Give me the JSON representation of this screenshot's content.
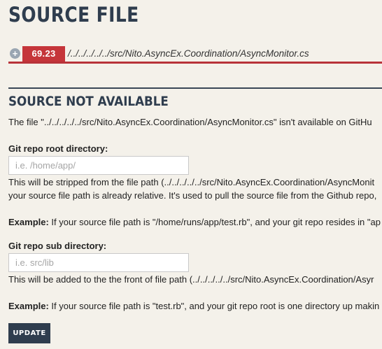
{
  "page": {
    "title": "SOURCE FILE"
  },
  "file": {
    "coverage": "69.23",
    "path": "/../../../../../src/Nito.AsyncEx.Coordination/AsyncMonitor.cs",
    "expand_icon": "plus-circle-icon"
  },
  "section": {
    "title": "SOURCE NOT AVAILABLE",
    "message": "The file \"../../../../../src/Nito.AsyncEx.Coordination/AsyncMonitor.cs\" isn't available on GitHu"
  },
  "repo_root": {
    "label": "Git repo root directory:",
    "placeholder": "i.e. /home/app/",
    "value": "",
    "help_line1": "This will be stripped from the file path (../../../../../src/Nito.AsyncEx.Coordination/AsyncMonit",
    "help_line2": "your source file path is already relative. It's used to pull the source file from the Github repo,",
    "example_label": "Example:",
    "example_text": " If your source file path is \"/home/runs/app/test.rb\", and your git repo resides in \"ap"
  },
  "repo_sub": {
    "label": "Git repo sub directory:",
    "placeholder": "i.e. src/lib",
    "value": "",
    "help_line1": "This will be added to the the front of file path (../../../../../src/Nito.AsyncEx.Coordination/Asyr",
    "example_label": "Example:",
    "example_text": " If your source file path is \"test.rb\", and your git repo root is one directory up makin"
  },
  "actions": {
    "update_label": "UPDATE"
  },
  "colors": {
    "accent": "#2f3d4e",
    "badge": "#c5353a",
    "background": "#f4f1ea"
  }
}
